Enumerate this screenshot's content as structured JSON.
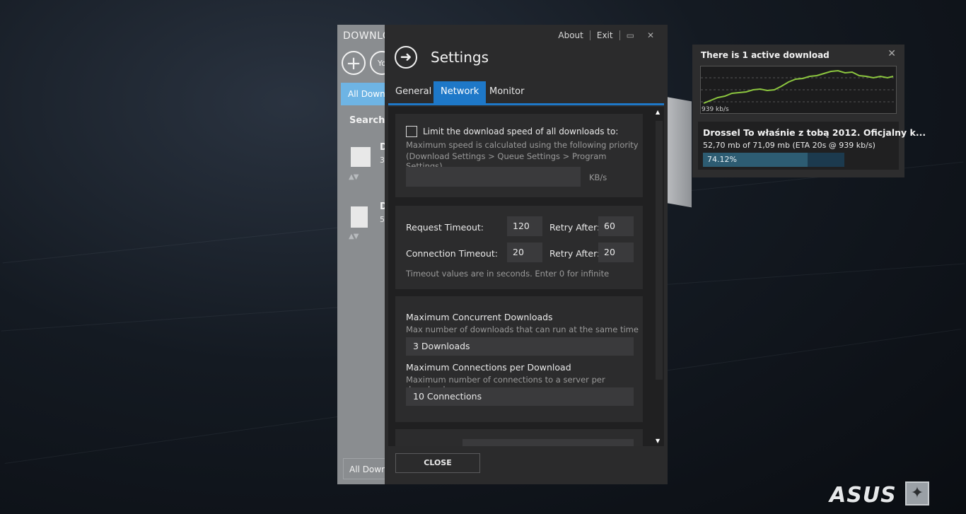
{
  "background_app": {
    "title": "DOWNLO",
    "filter_label": "All Downl",
    "search_label": "Search I",
    "items": [
      {
        "letter": "D",
        "detail": "3"
      },
      {
        "letter": "D",
        "detail": "5"
      }
    ],
    "footer_label": "All Downl"
  },
  "settings": {
    "header_links": {
      "about": "About",
      "exit": "Exit"
    },
    "title": "Settings",
    "tabs": [
      "General",
      "Network",
      "Monitor"
    ],
    "active_tab": "Network",
    "speed_limit": {
      "checkbox_label": "Limit the download speed of all downloads to:",
      "description_line1": "Maximum speed is calculated using the following priority",
      "description_line2": "(Download Settings > Queue Settings > Program Settings)",
      "value": "",
      "unit": "KB/s"
    },
    "timeouts": {
      "request_label": "Request Timeout:",
      "request_value": "120",
      "request_retry_label": "Retry After:",
      "request_retry_value": "60",
      "connection_label": "Connection Timeout:",
      "connection_value": "20",
      "connection_retry_label": "Retry After:",
      "connection_retry_value": "20",
      "note": "Timeout values are in seconds. Enter 0 for infinite"
    },
    "concurrency": {
      "max_downloads_label": "Maximum Concurrent Downloads",
      "max_downloads_desc": "Max number of downloads that can run at the same time",
      "max_downloads_value": "3 Downloads",
      "max_connections_label": "Maximum Connections per Download",
      "max_connections_desc": "Maximum number of connections to a server per download",
      "max_connections_value": "10 Connections"
    },
    "close_button": "CLOSE"
  },
  "monitor": {
    "title": "There is 1 active download",
    "graph_label": "939 kb/s",
    "item_name": "Drossel   To właśnie z tobą 2012. Oficjalny k...",
    "item_stats": "52,70 mb of 71,09 mb (ETA 20s @ 939 kb/s)",
    "progress_text": "74.12%",
    "progress_fraction": 0.7412,
    "graph_color": "#8cc63f"
  },
  "brand": {
    "logo_text": "ASUS"
  },
  "colors": {
    "accent": "#1e78c8",
    "panel": "#2b2b2c"
  }
}
